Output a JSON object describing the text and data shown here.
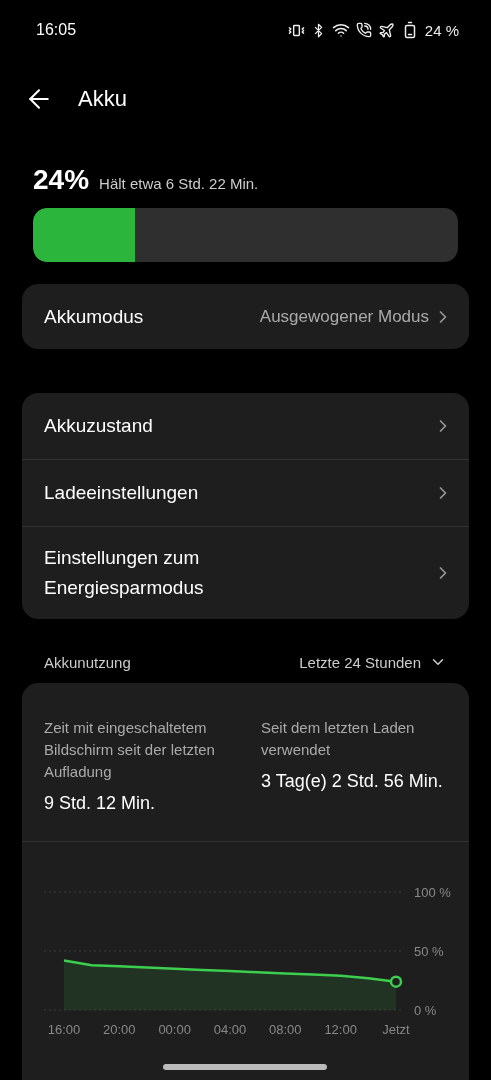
{
  "status_bar": {
    "time": "16:05",
    "battery": "24 %"
  },
  "header": {
    "title": "Akku"
  },
  "battery": {
    "percent": "24%",
    "remaining": "Hält etwa 6 Std. 22 Min.",
    "level": 0.24
  },
  "mode": {
    "label": "Akkumodus",
    "value": "Ausgewogener Modus"
  },
  "settings": [
    {
      "label": "Akkuzustand"
    },
    {
      "label": "Ladeeinstellungen"
    },
    {
      "label": "Einstellungen zum Energiesparmodus"
    }
  ],
  "usage": {
    "title": "Akkunutzung",
    "range": "Letzte 24 Stunden",
    "stats": [
      {
        "label": "Zeit mit eingeschaltetem Bildschirm seit der letzten Aufladung",
        "value": "9 Std. 12 Min."
      },
      {
        "label": "Seit dem letzten Laden verwendet",
        "value": "3 Tag(e) 2 Std. 56 Min."
      }
    ],
    "chart_data": {
      "type": "area",
      "categories": [
        "16:00",
        null,
        "20:00",
        null,
        "00:00",
        null,
        "04:00",
        null,
        "08:00",
        null,
        "12:00",
        null,
        "Jetzt"
      ],
      "series": [
        {
          "color": "#3ccf4e",
          "values": [
            42,
            38,
            37,
            36,
            35,
            34,
            33,
            32,
            31,
            30,
            29,
            27,
            24
          ]
        }
      ],
      "ylim": [
        0,
        100
      ],
      "yticks": [
        {
          "value": 0,
          "label": "0 %"
        },
        {
          "value": 50,
          "label": "50 %"
        },
        {
          "value": 100,
          "label": "100 %"
        }
      ]
    }
  }
}
